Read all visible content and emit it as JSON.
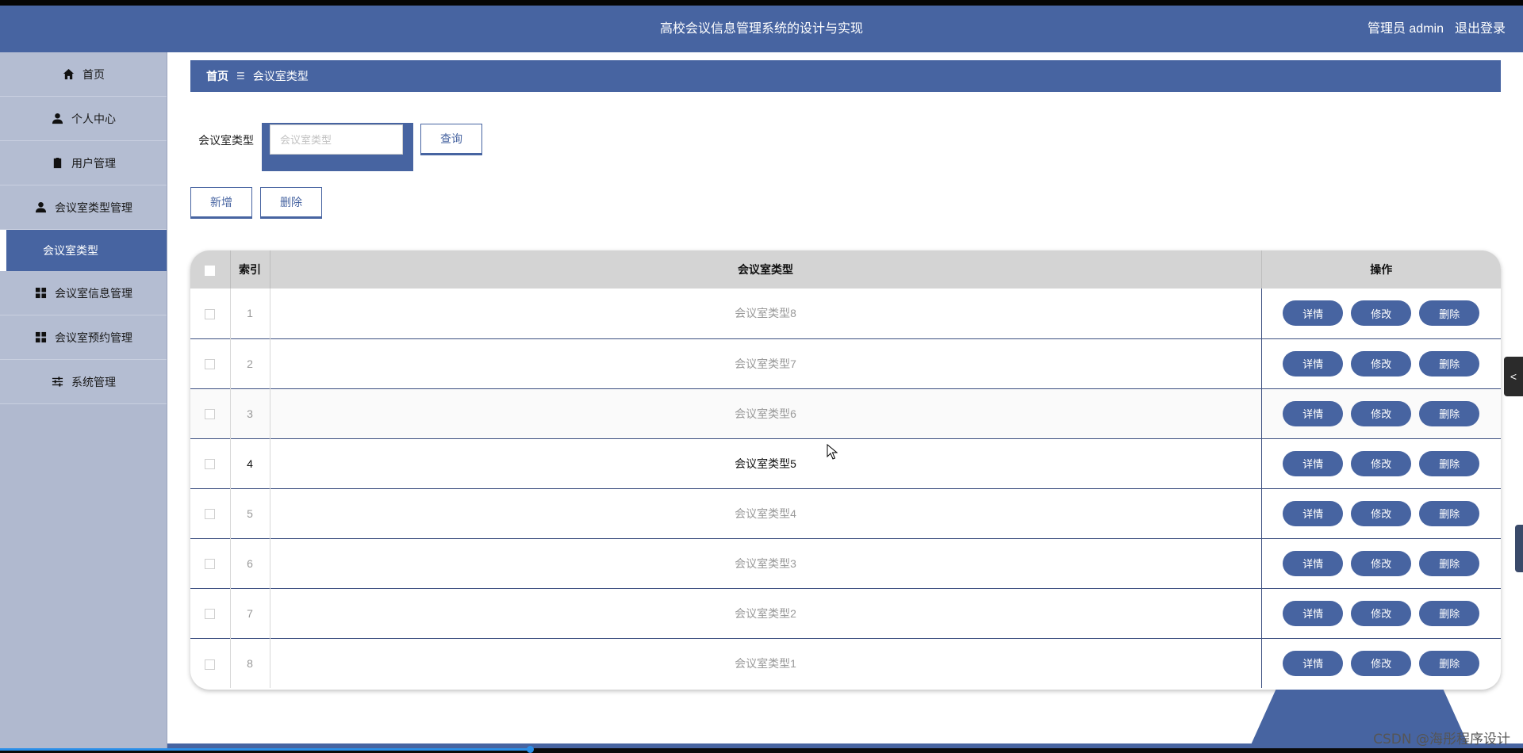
{
  "header": {
    "title": "高校会议信息管理系统的设计与实现",
    "user": "管理员 admin",
    "logout": "退出登录"
  },
  "sidebar": {
    "items": [
      {
        "label": "首页",
        "icon": "home-icon"
      },
      {
        "label": "个人中心",
        "icon": "user-icon"
      },
      {
        "label": "用户管理",
        "icon": "clipboard-icon"
      },
      {
        "label": "会议室类型管理",
        "icon": "user-icon"
      },
      {
        "label": "会议室类型",
        "icon": ""
      },
      {
        "label": "会议室信息管理",
        "icon": "grid-icon"
      },
      {
        "label": "会议室预约管理",
        "icon": "grid-icon"
      },
      {
        "label": "系统管理",
        "icon": "sliders-icon"
      }
    ]
  },
  "breadcrumb": {
    "home": "首页",
    "separator": "☰",
    "current": "会议室类型"
  },
  "search": {
    "label": "会议室类型",
    "placeholder": "会议室类型",
    "value": "",
    "query_button": "查询"
  },
  "actions": {
    "add": "新增",
    "delete": "删除"
  },
  "table": {
    "headers": {
      "index": "索引",
      "type": "会议室类型",
      "ops": "操作"
    },
    "rows": [
      {
        "index": "1",
        "type": "会议室类型8"
      },
      {
        "index": "2",
        "type": "会议室类型7"
      },
      {
        "index": "3",
        "type": "会议室类型6"
      },
      {
        "index": "4",
        "type": "会议室类型5"
      },
      {
        "index": "5",
        "type": "会议室类型4"
      },
      {
        "index": "6",
        "type": "会议室类型3"
      },
      {
        "index": "7",
        "type": "会议室类型2"
      },
      {
        "index": "8",
        "type": "会议室类型1"
      }
    ],
    "row_buttons": {
      "detail": "详情",
      "edit": "修改",
      "delete": "删除"
    }
  },
  "edge_tab": "<",
  "watermark": "CSDN @海彤程序设计",
  "colors": {
    "primary": "#4764a1",
    "sidebar_bg": "#b0b9cf",
    "table_header_bg": "#d4d4d4"
  }
}
